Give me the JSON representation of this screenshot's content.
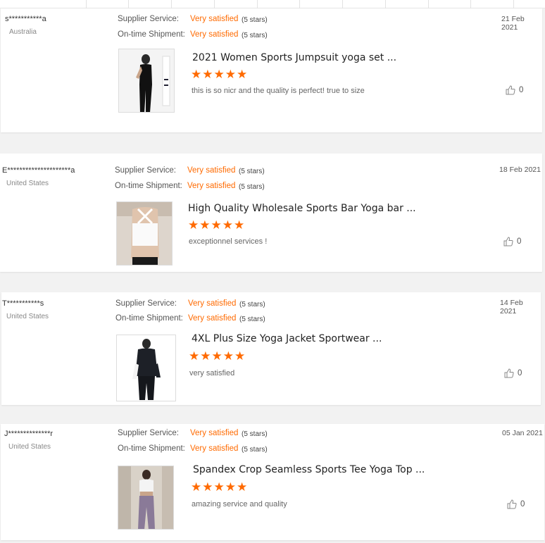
{
  "reviews": [
    {
      "user": "s***********a",
      "country": "Australia",
      "supplier_label": "Supplier Service:",
      "supplier_value": "Very satisfied",
      "supplier_stars": "(5 stars)",
      "shipment_label": "On-time Shipment:",
      "shipment_value": "Very satisfied",
      "shipment_stars": "(5 stars)",
      "date": "21 Feb 2021",
      "product_title": "2021 Women Sports Jumpsuit yoga set ...",
      "rating": 5,
      "stars_text": "★★★★★",
      "comment": "this is so nicr and the quality is perfect! true to size",
      "likes": "0"
    },
    {
      "user": "E*********************a",
      "country": "United States",
      "supplier_label": "Supplier Service:",
      "supplier_value": "Very satisfied",
      "supplier_stars": "(5 stars)",
      "shipment_label": "On-time Shipment:",
      "shipment_value": "Very satisfied",
      "shipment_stars": "(5 stars)",
      "date": "18 Feb 2021",
      "product_title": "High Quality Wholesale Sports Bar Yoga bar ...",
      "rating": 5,
      "stars_text": "★★★★★",
      "comment": "exceptionnel services !",
      "likes": "0"
    },
    {
      "user": "T***********s",
      "country": "United States",
      "supplier_label": "Supplier Service:",
      "supplier_value": "Very satisfied",
      "supplier_stars": "(5 stars)",
      "shipment_label": "On-time Shipment:",
      "shipment_value": "Very satisfied",
      "shipment_stars": "(5 stars)",
      "date": "14 Feb 2021",
      "product_title": "4XL Plus Size Yoga Jacket Sportwear ...",
      "rating": 5,
      "stars_text": "★★★★★",
      "comment": "very satisfied",
      "likes": "0"
    },
    {
      "user": "J**************r",
      "country": "United States",
      "supplier_label": "Supplier Service:",
      "supplier_value": "Very satisfied",
      "supplier_stars": "(5 stars)",
      "shipment_label": "On-time Shipment:",
      "shipment_value": "Very satisfied",
      "shipment_stars": "(5 stars)",
      "date": "05 Jan 2021",
      "product_title": "Spandex Crop Seamless Sports Tee Yoga Top ...",
      "rating": 5,
      "stars_text": "★★★★★",
      "comment": "amazing service and quality",
      "likes": "0"
    }
  ],
  "colors": {
    "accent": "#ff6a00",
    "card_bg": "#ffffff",
    "page_bg": "#f2f2f2"
  },
  "icons": {
    "like": "thumbs-up-icon",
    "star": "star-icon"
  }
}
